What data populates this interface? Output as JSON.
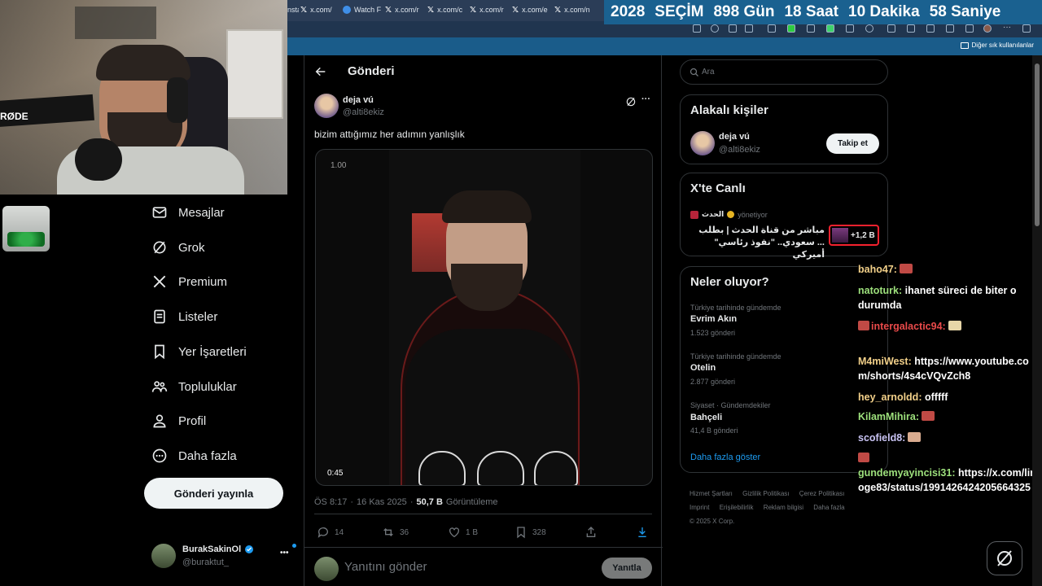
{
  "browser": {
    "tabs": [
      {
        "label": "nsta",
        "icon": "page-icon"
      },
      {
        "label": "x.com/",
        "icon": "x-logo-icon"
      },
      {
        "label": "Watch F",
        "icon": "globe-icon"
      },
      {
        "label": "x.com/r",
        "icon": "x-logo-icon"
      },
      {
        "label": "x.com/c",
        "icon": "x-logo-icon"
      },
      {
        "label": "x.com/r",
        "icon": "x-logo-icon"
      },
      {
        "label": "x.com/e",
        "icon": "x-logo-icon"
      },
      {
        "label": "x.com/n",
        "icon": "x-logo-icon"
      }
    ],
    "bookmarks_label": "Diğer sık kullanılanlar"
  },
  "countdown": {
    "year": "2028",
    "event": "SEÇİM",
    "days": "898 Gün",
    "hours": "18 Saat",
    "minutes": "10 Dakika",
    "seconds": "58 Saniye"
  },
  "nav": {
    "items": [
      {
        "label": "Mesajlar",
        "icon": "envelope-icon"
      },
      {
        "label": "Grok",
        "icon": "grok-icon"
      },
      {
        "label": "Premium",
        "icon": "x-logo-icon"
      },
      {
        "label": "Listeler",
        "icon": "list-icon"
      },
      {
        "label": "Yer İşaretleri",
        "icon": "bookmark-icon"
      },
      {
        "label": "Topluluklar",
        "icon": "people-icon"
      },
      {
        "label": "Profil",
        "icon": "person-icon"
      },
      {
        "label": "Daha fazla",
        "icon": "more-circle-icon"
      }
    ],
    "post_button": "Gönderi yayınla",
    "account": {
      "name": "BurakSakinOl",
      "handle": "@buraktut_",
      "more": "•••"
    }
  },
  "post": {
    "header_title": "Gönderi",
    "author_name": "deja vú",
    "author_handle": "@alti8ekiz",
    "text": "bizim attığımız her adımın yanlışlık",
    "video_speed": "1.00",
    "video_time": "0:45",
    "time": "ÖS 8:17",
    "date": "16 Kas 2025",
    "views_count": "50,7 B",
    "views_label": "Görüntüleme",
    "separator": "·",
    "stats": {
      "replies": "14",
      "reposts": "36",
      "likes": "1 B",
      "bookmarks": "328"
    },
    "reply_placeholder": "Yanıtını gönder",
    "reply_button": "Yanıtla"
  },
  "sidebar": {
    "search_placeholder": "Ara",
    "relevant_people": {
      "title": "Alakalı kişiler",
      "name": "deja vú",
      "handle": "@alti8ekiz",
      "follow_button": "Takip et"
    },
    "live": {
      "title": "X'te Canlı",
      "host": "الحدث",
      "host_role": "yönetiyor",
      "line1": "مباشر من قناة الحدث | بطلب",
      "line2": "... سعودي.. \"نفوذ رئاسي\" أميركي",
      "listeners": "+1,2 B"
    },
    "trends": {
      "title": "Neler oluyor?",
      "items": [
        {
          "category": "Türkiye tarihinde gündemde",
          "name": "Evrim Akın",
          "count": "1.523 gönderi"
        },
        {
          "category": "Türkiye tarihinde gündemde",
          "name": "Otelin",
          "count": "2.877 gönderi"
        },
        {
          "category": "Siyaset · Gündemdekiler",
          "name": "Bahçeli",
          "count": "41,4 B gönderi"
        }
      ],
      "show_more": "Daha fazla göster"
    },
    "footer": {
      "links": [
        "Hizmet Şartları",
        "Gizlilik Politikası",
        "Çerez Politikası",
        "Imprint",
        "Erişilebilirlik",
        "Reklam bilgisi",
        "Daha fazla"
      ],
      "copyright": "© 2025 X Corp."
    }
  },
  "chat": [
    {
      "name": "baho47:",
      "message": ""
    },
    {
      "name": "natoturk:",
      "message": "ihanet süreci de biter o durumda"
    },
    {
      "name": "intergalactic94:",
      "message": ""
    },
    {
      "name": "M4miWest:",
      "message": "https://www.youtube.com/shorts/4s4cVQvZch8"
    },
    {
      "name": "hey_arnoldd:",
      "message": "offfff"
    },
    {
      "name": "KilamMihira:",
      "message": ""
    },
    {
      "name": "scofield8:",
      "message": ""
    },
    {
      "name": "gundemyayincisi31:",
      "message": "https://x.com/linoge83/status/1991426424205664325"
    }
  ],
  "webcam": {
    "mic_brand": "RØDE"
  },
  "colors": {
    "accent": "#1d9bf0",
    "countdown_bg": "#1a6190",
    "chat_name": "#f2d089"
  }
}
